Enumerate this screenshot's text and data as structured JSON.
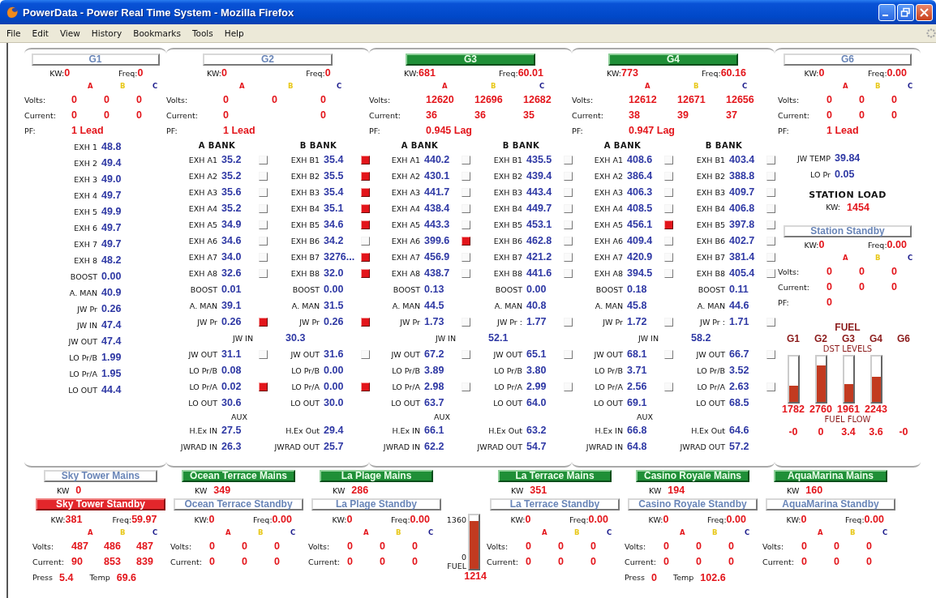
{
  "window": {
    "title": "PowerData - Power Real Time System - Mozilla Firefox"
  },
  "menu": [
    "File",
    "Edit",
    "View",
    "History",
    "Bookmarks",
    "Tools",
    "Help"
  ],
  "generators": [
    {
      "name": "G1",
      "running": false,
      "fault": false,
      "kw_label": "KW:",
      "kw": "0",
      "freq_label": "Freq:",
      "freq": "0",
      "phases": [
        {
          "label": "A",
          "color": "#e3151b"
        },
        {
          "label": "B",
          "color": "#e8c81a"
        },
        {
          "label": "C",
          "color": "#1c1c8c"
        }
      ],
      "volts_label": "Volts:",
      "volts": [
        "0",
        "0",
        "0"
      ],
      "current_label": "Current:",
      "current": [
        "0",
        "0",
        "0"
      ],
      "pf_label": "PF:",
      "pf": "1 Lead",
      "rows": [
        {
          "kind": "single",
          "label": "EXH 1",
          "value": "48.8"
        },
        {
          "kind": "single",
          "label": "EXH 2",
          "value": "49.4"
        },
        {
          "kind": "single",
          "label": "EXH 3",
          "value": "49.0"
        },
        {
          "kind": "single",
          "label": "EXH 4",
          "value": "49.7"
        },
        {
          "kind": "single",
          "label": "EXH 5",
          "value": "49.9"
        },
        {
          "kind": "single",
          "label": "EXH 6",
          "value": "49.7"
        },
        {
          "kind": "single",
          "label": "EXH 7",
          "value": "49.7"
        },
        {
          "kind": "single",
          "label": "EXH 8",
          "value": "48.2"
        },
        {
          "kind": "single",
          "label": "BOOST",
          "value": "0.00"
        },
        {
          "kind": "single",
          "label": "A. MAN",
          "value": "40.9"
        },
        {
          "kind": "single",
          "label": "JW Pr",
          "value": "0.26"
        },
        {
          "kind": "single",
          "label": "JW IN",
          "value": "47.4"
        },
        {
          "kind": "single",
          "label": "JW OUT",
          "value": "47.4"
        },
        {
          "kind": "single",
          "label": "LO Pr/B",
          "value": "1.99"
        },
        {
          "kind": "single",
          "label": "LO Pr/A",
          "value": "1.95"
        },
        {
          "kind": "single",
          "label": "LO OUT",
          "value": "44.4"
        }
      ]
    },
    {
      "name": "G2",
      "running": false,
      "fault": false,
      "kw_label": "KW:",
      "kw": "0",
      "freq_label": "Freq:",
      "freq": "0",
      "phases": [
        {
          "label": "A",
          "color": "#e3151b"
        },
        {
          "label": "B",
          "color": "#e8c81a"
        },
        {
          "label": "C",
          "color": "#1c1c8c"
        }
      ],
      "volts_label": "Volts:",
      "volts": [
        "0",
        "0",
        "0"
      ],
      "current_label": "Current:",
      "current": {
        "a": "0",
        "c": "0"
      },
      "pf_label": "PF:",
      "pf": "1 Lead",
      "rows": [
        {
          "kind": "banks",
          "a": "A BANK",
          "b": "B BANK"
        },
        {
          "kind": "pair",
          "a": {
            "label": "EXH A1",
            "value": "35.2",
            "alarm": false
          },
          "b": {
            "label": "EXH B1",
            "value": "35.4",
            "alarm": true
          }
        },
        {
          "kind": "pair",
          "a": {
            "label": "EXH A2",
            "value": "35.2",
            "alarm": false
          },
          "b": {
            "label": "EXH B2",
            "value": "35.5",
            "alarm": true
          }
        },
        {
          "kind": "pair",
          "a": {
            "label": "EXH A3",
            "value": "35.6",
            "alarm": false
          },
          "b": {
            "label": "EXH B3",
            "value": "35.4",
            "alarm": true
          }
        },
        {
          "kind": "pair",
          "a": {
            "label": "EXH A4",
            "value": "35.2",
            "alarm": false
          },
          "b": {
            "label": "EXH B4",
            "value": "35.1",
            "alarm": true
          }
        },
        {
          "kind": "pair",
          "a": {
            "label": "EXH A5",
            "value": "34.9",
            "alarm": false
          },
          "b": {
            "label": "EXH B5",
            "value": "34.6",
            "alarm": true
          }
        },
        {
          "kind": "pair",
          "a": {
            "label": "EXH A6",
            "value": "34.6",
            "alarm": false
          },
          "b": {
            "label": "EXH B6",
            "value": "34.2",
            "alarm": false
          }
        },
        {
          "kind": "pair",
          "a": {
            "label": "EXH A7",
            "value": "34.0",
            "alarm": false
          },
          "b": {
            "label": "EXH B7",
            "value": "3276...",
            "alarm": true
          }
        },
        {
          "kind": "pair",
          "a": {
            "label": "EXH A8",
            "value": "32.6",
            "alarm": false
          },
          "b": {
            "label": "EXH B8",
            "value": "32.0",
            "alarm": true
          }
        },
        {
          "kind": "pair",
          "a": {
            "label": "BOOST",
            "value": "0.01"
          },
          "b": {
            "label": "BOOST",
            "value": "0.00"
          }
        },
        {
          "kind": "pair",
          "a": {
            "label": "A. MAN",
            "value": "39.1"
          },
          "b": {
            "label": "A. MAN",
            "value": "31.5"
          }
        },
        {
          "kind": "pair",
          "a": {
            "label": "JW Pr",
            "value": "0.26",
            "alarm": true
          },
          "b": {
            "label": "JW Pr",
            "value": "0.26",
            "alarm": true
          }
        },
        {
          "kind": "shared",
          "label": "JW IN",
          "value": "30.3"
        },
        {
          "kind": "pair",
          "a": {
            "label": "JW OUT",
            "value": "31.1",
            "alarm": false
          },
          "b": {
            "label": "JW OUT",
            "value": "31.6",
            "alarm": false
          }
        },
        {
          "kind": "pair",
          "a": {
            "label": "LO Pr/B",
            "value": "0.08"
          },
          "b": {
            "label": "LO Pr/B",
            "value": "0.00"
          }
        },
        {
          "kind": "pair",
          "a": {
            "label": "LO Pr/A",
            "value": "0.02",
            "alarm": true
          },
          "b": {
            "label": "LO Pr/A",
            "value": "0.00",
            "alarm": true
          }
        },
        {
          "kind": "pair",
          "a": {
            "label": "LO OUT",
            "value": "30.6"
          },
          "b": {
            "label": "LO OUT",
            "value": "30.0"
          }
        },
        {
          "kind": "heading",
          "text": "AUX"
        },
        {
          "kind": "pair",
          "a": {
            "label": "H.Ex IN",
            "value": "27.5"
          },
          "b": {
            "label": "H.Ex Out",
            "value": "29.4"
          }
        },
        {
          "kind": "pair",
          "a": {
            "label": "JWRAD IN",
            "value": "26.3"
          },
          "b": {
            "label": "JWRAD OUT",
            "value": "25.7"
          }
        }
      ]
    },
    {
      "name": "G3",
      "running": true,
      "fault": false,
      "kw_label": "KW:",
      "kw": "681",
      "freq_label": "Freq:",
      "freq": "60.01",
      "phases": [
        {
          "label": "A",
          "color": "#e3151b"
        },
        {
          "label": "B",
          "color": "#e8c81a"
        },
        {
          "label": "C",
          "color": "#1c1c8c"
        }
      ],
      "volts_label": "Volts:",
      "volts": [
        "12620",
        "12696",
        "12682"
      ],
      "current_label": "Current:",
      "current": [
        "36",
        "36",
        "35"
      ],
      "pf_label": "PF:",
      "pf": "0.945 Lag",
      "rows": [
        {
          "kind": "banks",
          "a": "A BANK",
          "b": "B BANK"
        },
        {
          "kind": "pair",
          "a": {
            "label": "EXH A1",
            "value": "440.2",
            "alarm": false
          },
          "b": {
            "label": "EXH B1",
            "value": "435.5",
            "alarm": false
          }
        },
        {
          "kind": "pair",
          "a": {
            "label": "EXH A2",
            "value": "430.1",
            "alarm": false
          },
          "b": {
            "label": "EXH B2",
            "value": "439.4",
            "alarm": false
          }
        },
        {
          "kind": "pair",
          "a": {
            "label": "EXH A3",
            "value": "441.7",
            "alarm": false
          },
          "b": {
            "label": "EXH B3",
            "value": "443.4",
            "alarm": false
          }
        },
        {
          "kind": "pair",
          "a": {
            "label": "EXH A4",
            "value": "438.4",
            "alarm": false
          },
          "b": {
            "label": "EXH B4",
            "value": "449.7",
            "alarm": false
          }
        },
        {
          "kind": "pair",
          "a": {
            "label": "EXH A5",
            "value": "443.3",
            "alarm": false
          },
          "b": {
            "label": "EXH B5",
            "value": "453.1",
            "alarm": false
          }
        },
        {
          "kind": "pair",
          "a": {
            "label": "EXH A6",
            "value": "399.6",
            "alarm": true
          },
          "b": {
            "label": "EXH B6",
            "value": "462.8",
            "alarm": false
          }
        },
        {
          "kind": "pair",
          "a": {
            "label": "EXH A7",
            "value": "456.9",
            "alarm": false
          },
          "b": {
            "label": "EXH B7",
            "value": "421.2",
            "alarm": false
          }
        },
        {
          "kind": "pair",
          "a": {
            "label": "EXH A8",
            "value": "438.7",
            "alarm": false
          },
          "b": {
            "label": "EXH B8",
            "value": "441.6",
            "alarm": false
          }
        },
        {
          "kind": "pair",
          "a": {
            "label": "BOOST",
            "value": "0.13"
          },
          "b": {
            "label": "BOOST",
            "value": "0.00"
          }
        },
        {
          "kind": "pair",
          "a": {
            "label": "A. MAN",
            "value": "44.5"
          },
          "b": {
            "label": "A. MAN",
            "value": "40.8"
          }
        },
        {
          "kind": "pair",
          "a": {
            "label": "JW Pr",
            "value": "1.73",
            "alarm": false
          },
          "b": {
            "label": "JW Pr :",
            "value": "1.77",
            "alarm": false
          }
        },
        {
          "kind": "shared",
          "label": "JW IN",
          "value": "52.1"
        },
        {
          "kind": "pair",
          "a": {
            "label": "JW OUT",
            "value": "67.2",
            "alarm": false
          },
          "b": {
            "label": "JW OUT",
            "value": "65.1",
            "alarm": false
          }
        },
        {
          "kind": "pair",
          "a": {
            "label": "LO Pr/B",
            "value": "3.89"
          },
          "b": {
            "label": "LO Pr/B",
            "value": "3.80"
          }
        },
        {
          "kind": "pair",
          "a": {
            "label": "LO Pr/A",
            "value": "2.98",
            "alarm": false
          },
          "b": {
            "label": "LO Pr/A",
            "value": "2.99",
            "alarm": false
          }
        },
        {
          "kind": "pair",
          "a": {
            "label": "LO OUT",
            "value": "63.7"
          },
          "b": {
            "label": "LO OUT",
            "value": "64.0"
          }
        },
        {
          "kind": "heading",
          "text": "AUX"
        },
        {
          "kind": "pair",
          "a": {
            "label": "H.Ex IN",
            "value": "66.1"
          },
          "b": {
            "label": "H.Ex Out",
            "value": "63.2"
          }
        },
        {
          "kind": "pair",
          "a": {
            "label": "JWRAD IN",
            "value": "62.2"
          },
          "b": {
            "label": "JWRAD OUT",
            "value": "54.7"
          }
        }
      ]
    },
    {
      "name": "G4",
      "running": true,
      "fault": false,
      "kw_label": "KW:",
      "kw": "773",
      "freq_label": "Freq:",
      "freq": "60.16",
      "phases": [
        {
          "label": "A",
          "color": "#e3151b"
        },
        {
          "label": "B",
          "color": "#e8c81a"
        },
        {
          "label": "C",
          "color": "#1c1c8c"
        }
      ],
      "volts_label": "Volts:",
      "volts": [
        "12612",
        "12671",
        "12656"
      ],
      "current_label": "Current:",
      "current": [
        "38",
        "39",
        "37"
      ],
      "pf_label": "PF:",
      "pf": "0.947 Lag",
      "rows": [
        {
          "kind": "banks",
          "a": "A BANK",
          "b": "B BANK"
        },
        {
          "kind": "pair",
          "a": {
            "label": "EXH A1",
            "value": "408.6",
            "alarm": false
          },
          "b": {
            "label": "EXH B1",
            "value": "403.4",
            "alarm": false
          }
        },
        {
          "kind": "pair",
          "a": {
            "label": "EXH A2",
            "value": "386.4",
            "alarm": false
          },
          "b": {
            "label": "EXH B2",
            "value": "388.8",
            "alarm": false
          }
        },
        {
          "kind": "pair",
          "a": {
            "label": "EXH A3",
            "value": "406.3",
            "alarm": false
          },
          "b": {
            "label": "EXH B3",
            "value": "409.7",
            "alarm": false
          }
        },
        {
          "kind": "pair",
          "a": {
            "label": "EXH A4",
            "value": "408.5",
            "alarm": false
          },
          "b": {
            "label": "EXH B4",
            "value": "406.8",
            "alarm": false
          }
        },
        {
          "kind": "pair",
          "a": {
            "label": "EXH A5",
            "value": "456.1",
            "alarm": true
          },
          "b": {
            "label": "EXH B5",
            "value": "397.8",
            "alarm": false
          }
        },
        {
          "kind": "pair",
          "a": {
            "label": "EXH A6",
            "value": "409.4",
            "alarm": false
          },
          "b": {
            "label": "EXH B6",
            "value": "402.7",
            "alarm": false
          }
        },
        {
          "kind": "pair",
          "a": {
            "label": "EXH A7",
            "value": "420.9",
            "alarm": false
          },
          "b": {
            "label": "EXH B7",
            "value": "381.4",
            "alarm": false
          }
        },
        {
          "kind": "pair",
          "a": {
            "label": "EXH A8",
            "value": "394.5",
            "alarm": false
          },
          "b": {
            "label": "EXH B8",
            "value": "405.4",
            "alarm": false
          }
        },
        {
          "kind": "pair",
          "a": {
            "label": "BOOST",
            "value": "0.18"
          },
          "b": {
            "label": "BOOST",
            "value": "0.11"
          }
        },
        {
          "kind": "pair",
          "a": {
            "label": "A. MAN",
            "value": "45.8"
          },
          "b": {
            "label": "A. MAN",
            "value": "44.6"
          }
        },
        {
          "kind": "pair",
          "a": {
            "label": "JW Pr",
            "value": "1.72",
            "alarm": false
          },
          "b": {
            "label": "JW Pr :",
            "value": "1.71",
            "alarm": false
          }
        },
        {
          "kind": "shared",
          "label": "JW IN",
          "value": "58.2"
        },
        {
          "kind": "pair",
          "a": {
            "label": "JW OUT",
            "value": "68.1",
            "alarm": false
          },
          "b": {
            "label": "JW OUT",
            "value": "66.7",
            "alarm": false
          }
        },
        {
          "kind": "pair",
          "a": {
            "label": "LO Pr/B",
            "value": "3.71"
          },
          "b": {
            "label": "LO Pr/B",
            "value": "3.52"
          }
        },
        {
          "kind": "pair",
          "a": {
            "label": "LO Pr/A",
            "value": "2.56",
            "alarm": false
          },
          "b": {
            "label": "LO Pr/A",
            "value": "2.63",
            "alarm": false
          }
        },
        {
          "kind": "pair",
          "a": {
            "label": "LO OUT",
            "value": "69.1"
          },
          "b": {
            "label": "LO OUT",
            "value": "68.5"
          }
        },
        {
          "kind": "heading",
          "text": "AUX"
        },
        {
          "kind": "pair",
          "a": {
            "label": "H.Ex IN",
            "value": "66.8"
          },
          "b": {
            "label": "H.Ex Out",
            "value": "64.6"
          }
        },
        {
          "kind": "pair",
          "a": {
            "label": "JWRAD IN",
            "value": "64.8"
          },
          "b": {
            "label": "JWRAD OUT",
            "value": "57.2"
          }
        }
      ]
    },
    {
      "name": "G6",
      "running": false,
      "fault": false,
      "kw_label": "KW:",
      "kw": "0",
      "freq_label": "Freq:",
      "freq": "0.00",
      "phases": [
        {
          "label": "A",
          "color": "#e3151b"
        },
        {
          "label": "B",
          "color": "#e8c81a"
        },
        {
          "label": "C",
          "color": "#1c1c8c"
        }
      ],
      "volts_label": "Volts:",
      "volts": [
        "0",
        "0",
        "0"
      ],
      "current_label": "Current:",
      "current": [
        "0",
        "0",
        "0"
      ],
      "pf_label": "PF:",
      "pf": "1 Lead",
      "rows": [
        {
          "kind": "single",
          "label": "JW TEMP",
          "value": "39.84"
        },
        {
          "kind": "single",
          "label": "LO Pr",
          "value": "0.05"
        }
      ]
    }
  ],
  "station_load": {
    "title": "STATION LOAD",
    "label": "KW:",
    "value": "1454"
  },
  "station_standby": {
    "name": "Station Standby",
    "running": false,
    "fault": false,
    "kw_label": "KW:",
    "kw": "0",
    "freq_label": "Freq:",
    "freq": "0.00",
    "phases": [
      {
        "label": "A",
        "color": "#e3151b"
      },
      {
        "label": "B",
        "color": "#e8c81a"
      },
      {
        "label": "C",
        "color": "#1c1c8c"
      }
    ],
    "volts_label": "Volts:",
    "volts": [
      "0",
      "0",
      "0"
    ],
    "current_label": "Current:",
    "current": [
      "0",
      "0",
      "0"
    ],
    "pf_label": "PF:",
    "pf": "0"
  },
  "fuel": {
    "title": "FUEL",
    "subtitle": "DST LEVELS",
    "flow_title": "FUEL FLOW",
    "tanks": [
      {
        "name": "G1",
        "level": 0.35,
        "reading": "1782",
        "flow": "-0"
      },
      {
        "name": "G2",
        "level": 0.8,
        "reading": "2760",
        "flow": "0"
      },
      {
        "name": "G3",
        "level": 0.4,
        "reading": "1961",
        "flow": "3.4"
      },
      {
        "name": "G4",
        "level": 0.55,
        "reading": "2243",
        "flow": "3.6"
      },
      {
        "name": "G6",
        "flow": "-0"
      }
    ]
  },
  "sites": [
    {
      "kind": "station",
      "mains": {
        "name": "Sky Tower Mains",
        "running": false,
        "fault": false,
        "kw_label": "KW",
        "kw": "0"
      },
      "standby": {
        "name": "Sky Tower Standby",
        "running": false,
        "fault": true,
        "kw_label": "KW:",
        "kw": "381",
        "freq_label": "Freq:",
        "freq": "59.97",
        "phases": [
          {
            "label": "A",
            "color": "#e3151b"
          },
          {
            "label": "B",
            "color": "#e8c81a"
          },
          {
            "label": "C",
            "color": "#1c1c8c"
          }
        ],
        "volts_label": "Volts:",
        "volts": [
          "487",
          "486",
          "487"
        ],
        "current_label": "Current:",
        "current": [
          "90",
          "853",
          "839"
        ]
      },
      "extras": [
        {
          "label": "Press",
          "value": "5.4"
        },
        {
          "label": "Temp",
          "value": "69.6"
        }
      ]
    },
    {
      "kind": "station",
      "mains": {
        "name": "Ocean Terrace Mains",
        "running": true,
        "fault": false,
        "kw_label": "KW",
        "kw": "349"
      },
      "standby": {
        "name": "Ocean Terrace Standby",
        "running": false,
        "fault": false,
        "kw_label": "KW:",
        "kw": "0",
        "freq_label": "Freq:",
        "freq": "0.00",
        "phases": [
          {
            "label": "A",
            "color": "#e3151b"
          },
          {
            "label": "B",
            "color": "#e8c81a"
          },
          {
            "label": "C",
            "color": "#1c1c8c"
          }
        ],
        "volts_label": "Volts:",
        "volts": [
          "0",
          "0",
          "0"
        ],
        "current_label": "Current:",
        "current": [
          "0",
          "0",
          "0"
        ]
      }
    },
    {
      "kind": "station",
      "mains": {
        "name": "La Plage Mains",
        "running": true,
        "fault": false,
        "kw_label": "KW",
        "kw": "286"
      },
      "standby": {
        "name": "La Plage Standby",
        "running": false,
        "fault": false,
        "kw_label": "KW:",
        "kw": "0",
        "freq_label": "Freq:",
        "freq": "0.00",
        "phases": [
          {
            "label": "A",
            "color": "#e3151b"
          },
          {
            "label": "B",
            "color": "#e8c81a"
          },
          {
            "label": "C",
            "color": "#1c1c8c"
          }
        ],
        "volts_label": "Volts:",
        "volts": [
          "0",
          "0",
          "0"
        ],
        "current_label": "Current:",
        "current": [
          "0",
          "0",
          "0"
        ]
      }
    },
    {
      "kind": "gauge",
      "max": "1360",
      "min": "0",
      "label": "FUEL",
      "reading": "1214",
      "level": 0.89
    },
    {
      "kind": "station",
      "mains": {
        "name": "La Terrace Mains",
        "running": true,
        "fault": false,
        "kw_label": "KW",
        "kw": "351"
      },
      "standby": {
        "name": "La Terrace Standby",
        "running": false,
        "fault": false,
        "kw_label": "KW:",
        "kw": "0",
        "freq_label": "Freq:",
        "freq": "0.00",
        "phases": [
          {
            "label": "A",
            "color": "#e3151b"
          },
          {
            "label": "B",
            "color": "#e8c81a"
          },
          {
            "label": "C",
            "color": "#1c1c8c"
          }
        ],
        "volts_label": "Volts:",
        "volts": [
          "0",
          "0",
          "0"
        ],
        "current_label": "Current:",
        "current": [
          "0",
          "0",
          "0"
        ]
      }
    },
    {
      "kind": "station",
      "mains": {
        "name": "Casino Royale Mains",
        "running": true,
        "fault": false,
        "kw_label": "KW",
        "kw": "194"
      },
      "standby": {
        "name": "Casino Royale Standby",
        "running": false,
        "fault": false,
        "kw_label": "KW:",
        "kw": "0",
        "freq_label": "Freq:",
        "freq": "0.00",
        "phases": [
          {
            "label": "A",
            "color": "#e3151b"
          },
          {
            "label": "B",
            "color": "#e8c81a"
          },
          {
            "label": "C",
            "color": "#1c1c8c"
          }
        ],
        "volts_label": "Volts:",
        "volts": [
          "0",
          "0",
          "0"
        ],
        "current_label": "Current:",
        "current": [
          "0",
          "0",
          "0"
        ]
      },
      "extras": [
        {
          "label": "Press",
          "value": "0"
        },
        {
          "label": "Temp",
          "value": "102.6"
        }
      ]
    },
    {
      "kind": "station",
      "mains": {
        "name": "AquaMarina Mains",
        "running": true,
        "fault": false,
        "kw_label": "KW",
        "kw": "160"
      },
      "standby": {
        "name": "AquaMarina Standby",
        "running": false,
        "fault": false,
        "kw_label": "KW:",
        "kw": "0",
        "freq_label": "Freq:",
        "freq": "0.00",
        "phases": [
          {
            "label": "A",
            "color": "#e3151b"
          },
          {
            "label": "B",
            "color": "#e8c81a"
          },
          {
            "label": "C",
            "color": "#1c1c8c"
          }
        ],
        "volts_label": "Volts:",
        "volts": [
          "0",
          "0",
          "0"
        ],
        "current_label": "Current:",
        "current": [
          "0",
          "0",
          "0"
        ]
      }
    }
  ]
}
